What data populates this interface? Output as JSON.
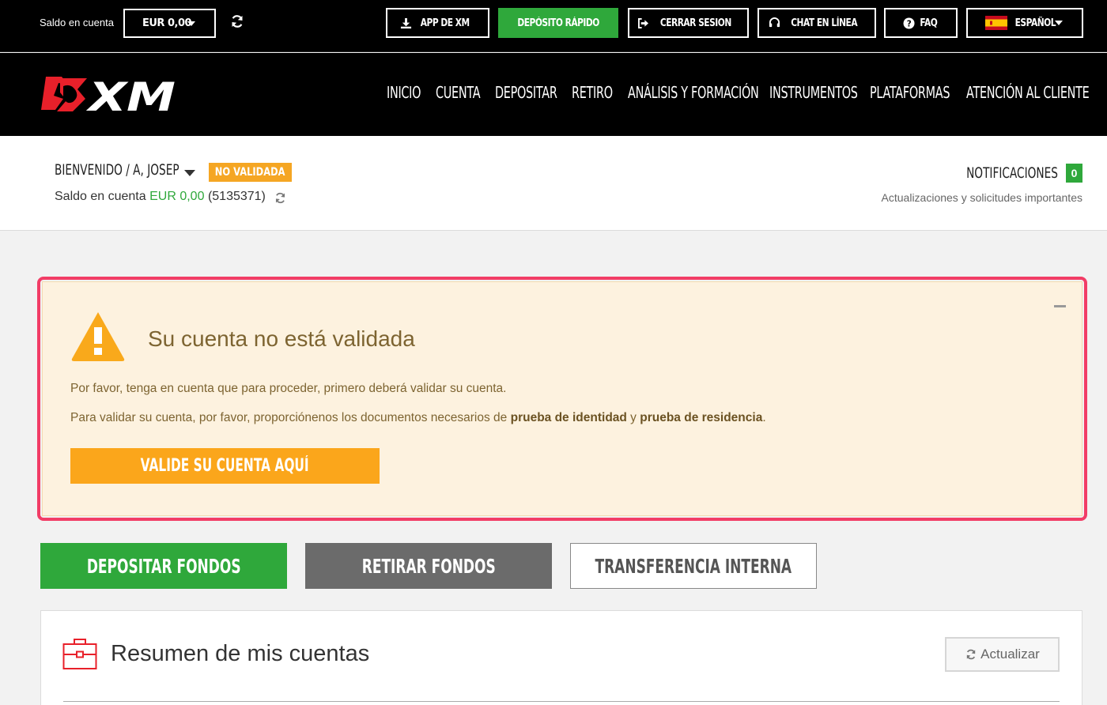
{
  "topbar": {
    "balance_label": "Saldo en cuenta",
    "balance_select": "EUR 0,00",
    "buttons": {
      "app": "APP DE XM",
      "deposit_fast": "DEPÓSITO RÁPIDO",
      "logout": "CERRAR SESION",
      "chat": "CHAT EN LÍNEA",
      "faq": "FAQ",
      "language": "ESPAÑOL"
    }
  },
  "nav": {
    "logo_text": "XM",
    "items": [
      "INICIO",
      "CUENTA",
      "DEPOSITAR",
      "RETIRO",
      "ANÁLISIS Y FORMACIÓN",
      "INSTRUMENTOS",
      "PLATAFORMAS",
      "ATENCIÓN AL CLIENTE"
    ]
  },
  "welcome": {
    "greeting": "BIENVENIDO / A, JOSEP",
    "status_badge": "NO VALIDADA",
    "balance_label": "Saldo en cuenta",
    "balance_amount": "EUR 0,00",
    "account_number": "(5135371)",
    "notifications_label": "NOTIFICACIONES",
    "notifications_count": "0",
    "notifications_sub": "Actualizaciones y solicitudes importantes"
  },
  "alert": {
    "title": "Su cuenta no está validada",
    "line1": "Por favor, tenga en cuenta que para proceder, primero deberá validar su cuenta.",
    "line2_pre": "Para validar su cuenta, por favor, proporciónenos los documentos necesarios de ",
    "line2_bold1": "prueba de identidad",
    "line2_mid": " y ",
    "line2_bold2": "prueba de residencia",
    "line2_post": ".",
    "button": "VALIDE SU CUENTA AQUÍ"
  },
  "actions": {
    "deposit": "DEPOSITAR FONDOS",
    "withdraw": "RETIRAR FONDOS",
    "transfer": "TRANSFERENCIA INTERNA"
  },
  "summary": {
    "title": "Resumen de mis cuentas",
    "refresh_label": "Actualizar"
  },
  "colors": {
    "green": "#2fa83b",
    "orange": "#fba61b",
    "alert_border": "#f23d66",
    "alert_bg": "#fdf2df",
    "brand_red": "#e8202a"
  },
  "icons": {
    "refresh": "refresh-icon",
    "download": "download-icon",
    "logout": "logout-icon",
    "headset": "headset-icon",
    "help": "question-icon",
    "flag": "spain-flag-icon",
    "warning": "warning-icon",
    "briefcase": "briefcase-icon"
  }
}
